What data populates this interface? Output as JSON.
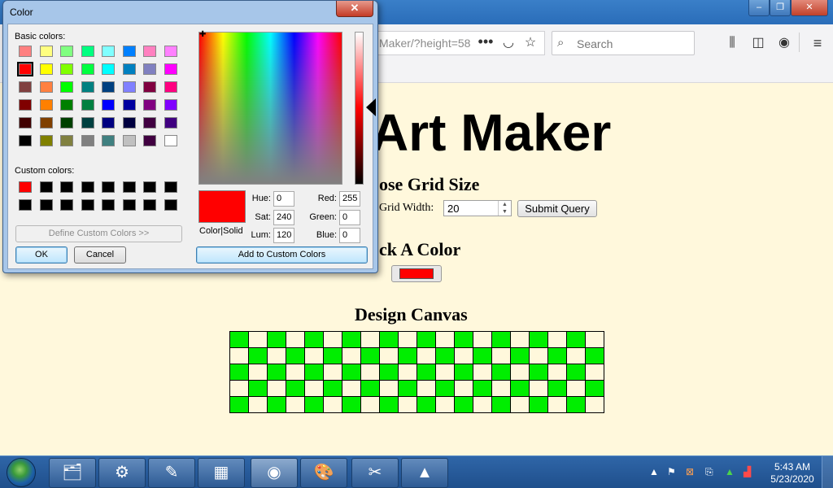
{
  "browser": {
    "url_fragment": "Maker/?height=58",
    "search_placeholder": "Search",
    "page_actions_icon": "ellipsis-icon",
    "pocket_icon": "pocket-icon",
    "bookmark_icon": "star-icon",
    "library_icon": "library-icon",
    "sidebar_icon": "sidebar-icon",
    "account_icon": "account-icon",
    "menu_icon": "hamburger-icon",
    "window_controls": {
      "minimize": "–",
      "maximize": "❐",
      "close": "✕"
    }
  },
  "page": {
    "title": "Art Maker",
    "grid_heading": "ose Grid Size",
    "grid_width_label": "Grid Width:",
    "grid_width_value": "20",
    "submit_label": "Submit Query",
    "color_heading": "ck A Color",
    "picked_color": "#ff0000",
    "canvas_heading": "Design Canvas",
    "canvas": {
      "rows": 5,
      "cols": 20,
      "fill_color": "#00ee00",
      "background_color": "#fff8dc",
      "pattern": "checkerboard"
    }
  },
  "dialog": {
    "title": "Color",
    "close_label": "✕",
    "basic_colors_label": "Basic colors:",
    "basic_colors": [
      [
        "#ff8080",
        "#ffff80",
        "#80ff80",
        "#00ff80",
        "#80ffff",
        "#0080ff",
        "#ff80c0",
        "#ff80ff"
      ],
      [
        "#ff0000",
        "#ffff00",
        "#80ff00",
        "#00ff40",
        "#00ffff",
        "#0080c0",
        "#8080c0",
        "#ff00ff"
      ],
      [
        "#804040",
        "#ff8040",
        "#00ff00",
        "#008080",
        "#004080",
        "#8080ff",
        "#800040",
        "#ff0080"
      ],
      [
        "#800000",
        "#ff8000",
        "#008000",
        "#008040",
        "#0000ff",
        "#0000a0",
        "#800080",
        "#8000ff"
      ],
      [
        "#400000",
        "#804000",
        "#004000",
        "#004040",
        "#000080",
        "#000040",
        "#400040",
        "#400080"
      ],
      [
        "#000000",
        "#808000",
        "#808040",
        "#808080",
        "#408080",
        "#c0c0c0",
        "#400040",
        "#ffffff"
      ]
    ],
    "selected_basic": {
      "row": 1,
      "col": 0
    },
    "custom_colors_label": "Custom colors:",
    "custom_colors": [
      [
        "#ff0000",
        "#000000",
        "#000000",
        "#000000",
        "#000000",
        "#000000",
        "#000000",
        "#000000"
      ],
      [
        "#000000",
        "#000000",
        "#000000",
        "#000000",
        "#000000",
        "#000000",
        "#000000",
        "#000000"
      ]
    ],
    "define_custom_label": "Define Custom Colors >>",
    "ok_label": "OK",
    "cancel_label": "Cancel",
    "preview_label": "Color|Solid",
    "hue_label": "Hue:",
    "hue": "0",
    "sat_label": "Sat:",
    "sat": "240",
    "lum_label": "Lum:",
    "lum": "120",
    "red_label": "Red:",
    "red": "255",
    "green_label": "Green:",
    "green": "0",
    "blue_label": "Blue:",
    "blue": "0",
    "add_custom_label": "Add to Custom Colors",
    "current_color": "#ff0000"
  },
  "taskbar": {
    "start_icon": "windows-start-icon",
    "apps": [
      {
        "name": "file-explorer-icon",
        "glyph": "🗂"
      },
      {
        "name": "xampp-icon",
        "glyph": "⚙"
      },
      {
        "name": "notepad-plus-plus-icon",
        "glyph": "✎"
      },
      {
        "name": "calculator-icon",
        "glyph": "▦"
      },
      {
        "name": "firefox-icon",
        "glyph": "◉"
      },
      {
        "name": "paint-icon",
        "glyph": "🎨"
      },
      {
        "name": "snipping-tool-icon",
        "glyph": "✂"
      },
      {
        "name": "sketchup-icon",
        "glyph": "▲"
      }
    ],
    "tray": [
      "show-hidden-icons-icon",
      "action-center-flag-icon",
      "xampp-tray-icon",
      "usb-device-icon",
      "sketchup-tray-icon",
      "network-signal-icon"
    ],
    "time": "5:43 AM",
    "date": "5/23/2020"
  }
}
